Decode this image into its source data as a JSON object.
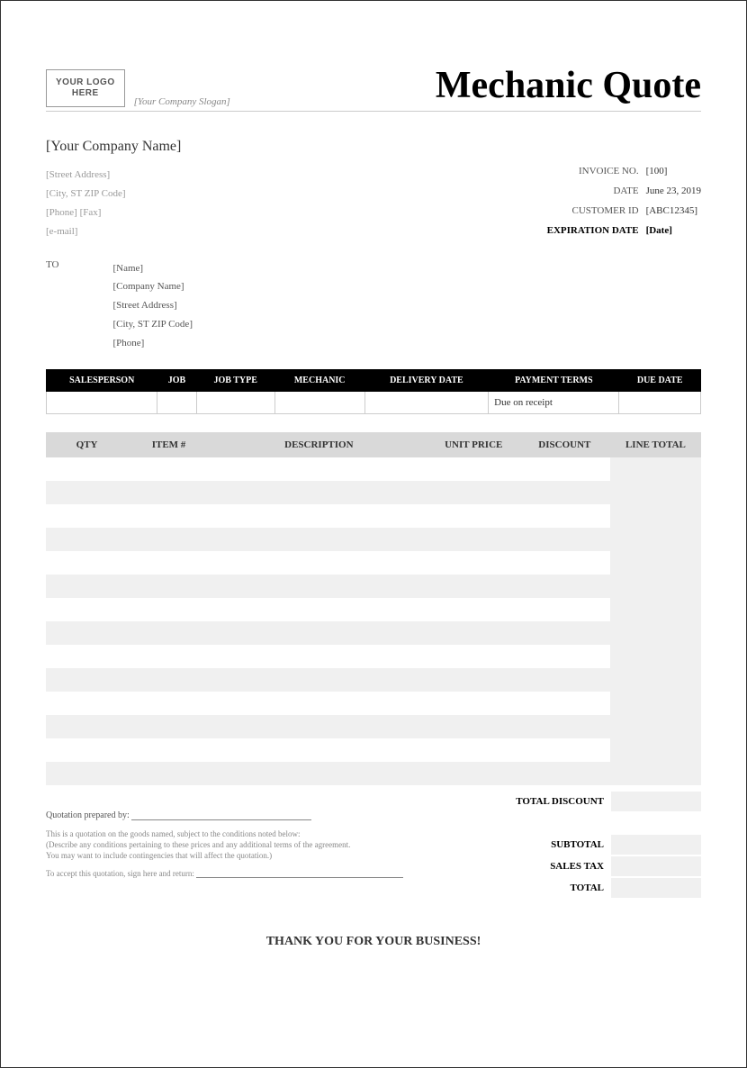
{
  "header": {
    "logo_line1": "YOUR LOGO",
    "logo_line2": "HERE",
    "slogan": "[Your Company Slogan]",
    "title": "Mechanic Quote"
  },
  "company": {
    "name": "[Your Company Name]",
    "street": "[Street Address]",
    "city": "[City, ST  ZIP Code]",
    "phone_fax": "[Phone] [Fax]",
    "email": "[e-mail]"
  },
  "meta": {
    "invoice_no_label": "INVOICE NO.",
    "invoice_no": "[100]",
    "date_label": "DATE",
    "date": "June 23, 2019",
    "customer_id_label": "CUSTOMER ID",
    "customer_id": "[ABC12345]",
    "expiration_label": "EXPIRATION DATE",
    "expiration": "[Date]"
  },
  "to": {
    "label": "TO",
    "name": "[Name]",
    "company": "[Company Name]",
    "street": "[Street Address]",
    "city": "[City, ST  ZIP Code]",
    "phone": "[Phone]"
  },
  "job_table": {
    "headers": [
      "SALESPERSON",
      "JOB",
      "JOB TYPE",
      "MECHANIC",
      "DELIVERY DATE",
      "PAYMENT TERMS",
      "DUE DATE"
    ],
    "row": [
      "",
      "",
      "",
      "",
      "",
      "Due on receipt",
      ""
    ]
  },
  "items_table": {
    "headers": [
      "QTY",
      "ITEM #",
      "DESCRIPTION",
      "UNIT PRICE",
      "DISCOUNT",
      "LINE TOTAL"
    ],
    "row_count": 14
  },
  "totals": {
    "total_discount": "TOTAL DISCOUNT",
    "subtotal": "SUBTOTAL",
    "sales_tax": "SALES TAX",
    "total": "TOTAL"
  },
  "notes": {
    "prepared_by": "Quotation prepared by:",
    "line1": "This is a quotation on the goods named, subject to the conditions noted below:",
    "line2": "(Describe any conditions pertaining to these prices and any additional terms of the agreement.",
    "line3": "You may want to include contingencies that will affect the quotation.)",
    "accept": "To accept this quotation, sign here and return:"
  },
  "thanks": "THANK YOU FOR YOUR BUSINESS!"
}
